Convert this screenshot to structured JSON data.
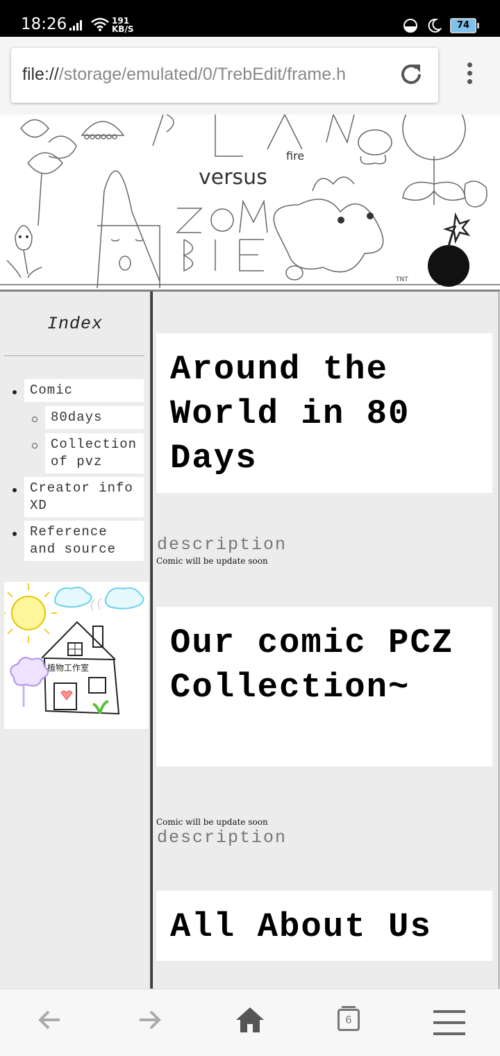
{
  "status": {
    "time": "18:26",
    "speed_value": "191",
    "speed_unit": "KB/S",
    "battery": "74"
  },
  "browser": {
    "url_scheme": "file://",
    "url_path": "/storage/emulated/0/TrebEdit/frame.h",
    "tab_count": "6"
  },
  "sidebar": {
    "title": "Index",
    "items": [
      {
        "label": "Comic"
      },
      {
        "label": "80days"
      },
      {
        "label": "Collection of pvz"
      },
      {
        "label": "Creator info XD"
      },
      {
        "label": "Reference and source"
      }
    ]
  },
  "main": {
    "sections": [
      {
        "title": "Around the World in 80 Days",
        "desc_label": "description",
        "note": "Comic will be update soon"
      },
      {
        "title": "Our comic PCZ Collection~",
        "desc_label": "description",
        "note": "Comic will be update soon"
      },
      {
        "title": "All About Us"
      }
    ]
  },
  "banner": {
    "doodle_text": [
      "versus",
      "fire",
      "TNT"
    ]
  },
  "house_sign": "植物工作室"
}
